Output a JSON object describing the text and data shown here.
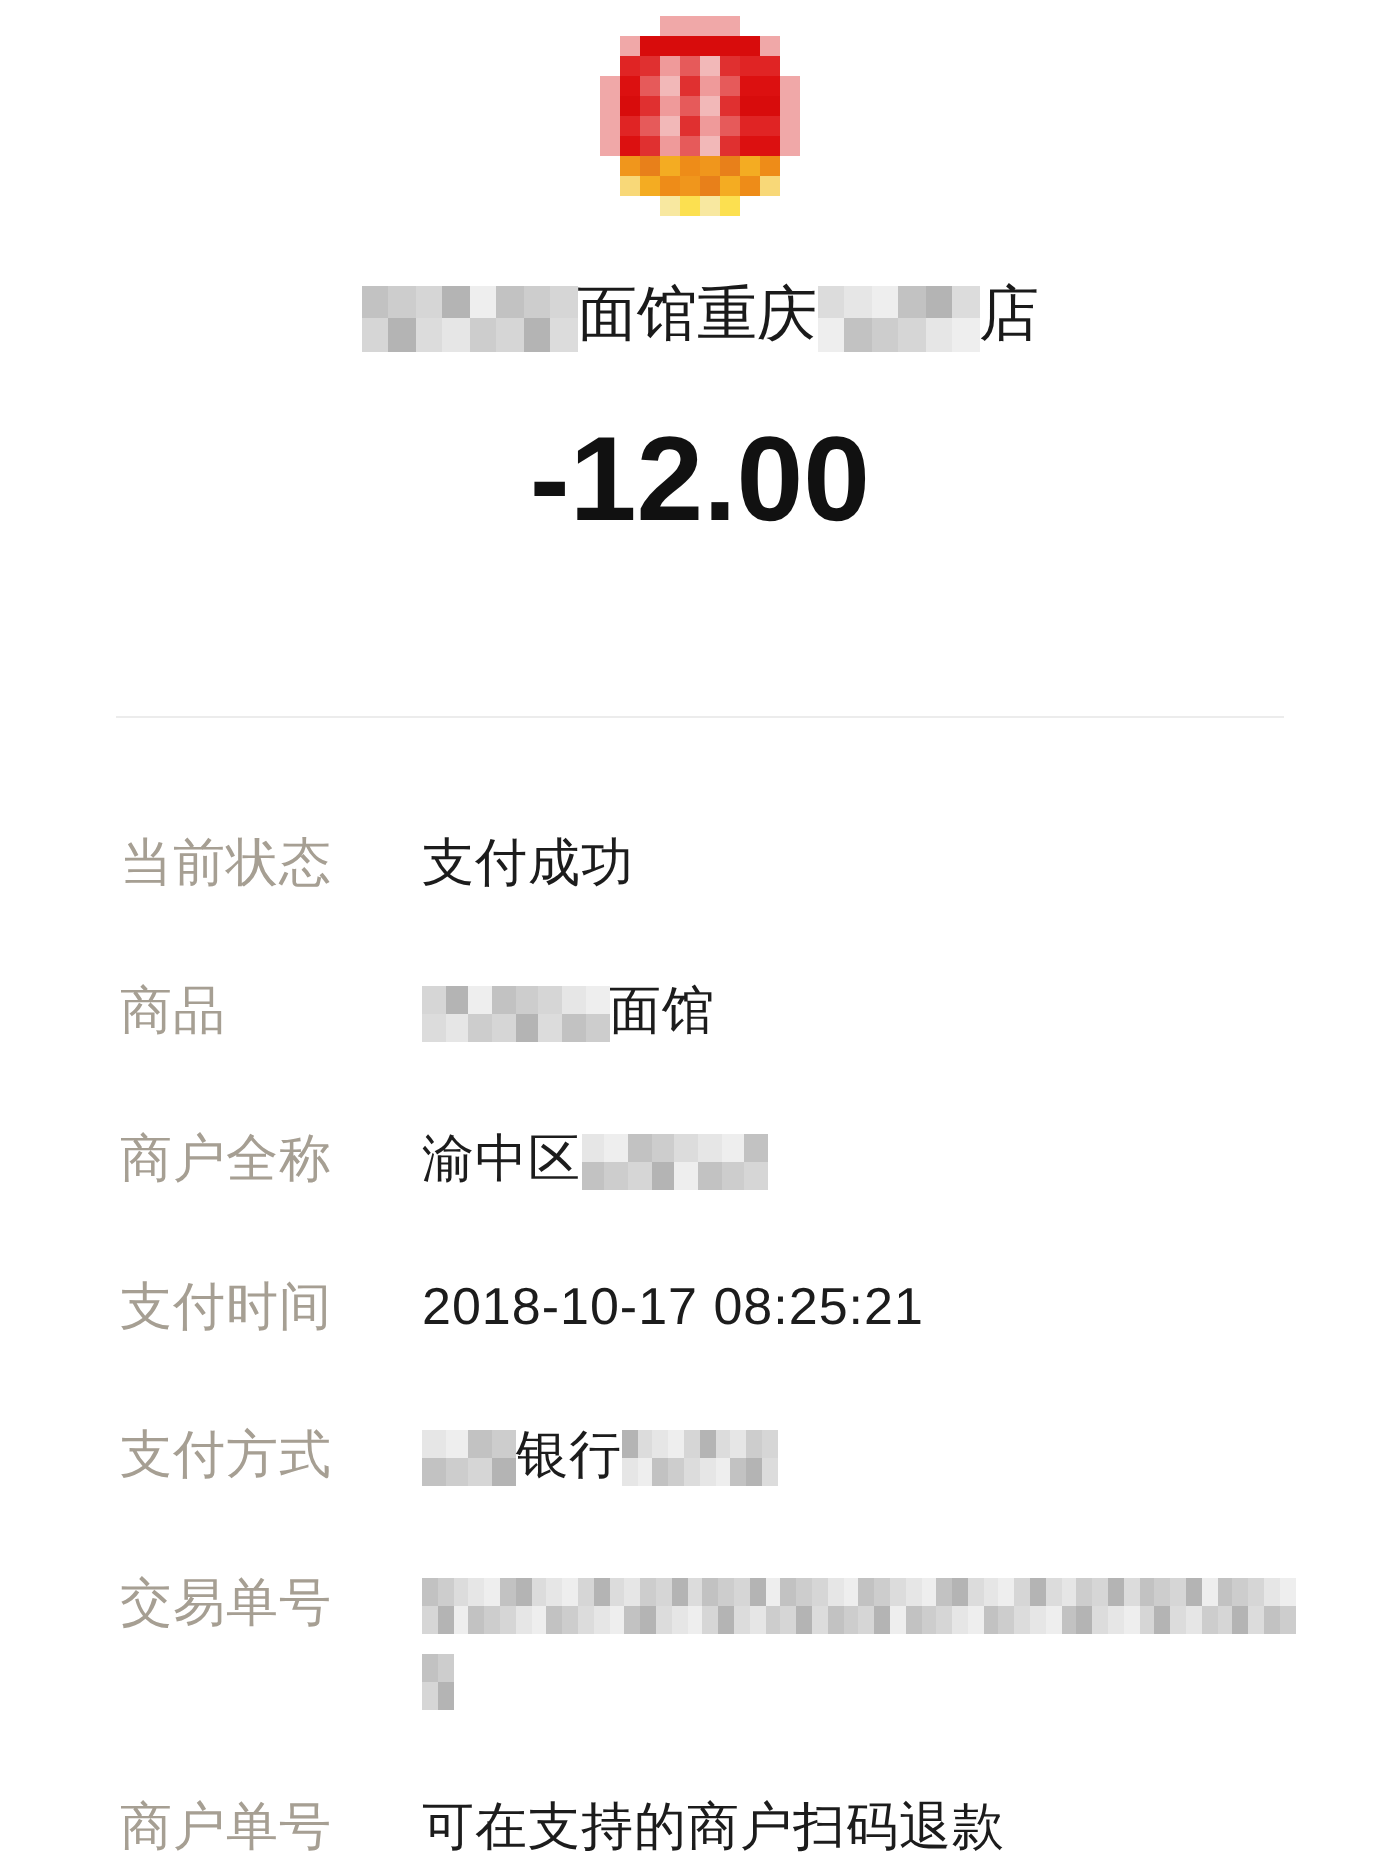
{
  "header": {
    "merchant_name": [
      {
        "kind": "blur4"
      },
      {
        "kind": "text",
        "text": "面馆重庆"
      },
      {
        "kind": "blur3"
      },
      {
        "kind": "text",
        "text": "店"
      }
    ],
    "amount": "-12.00"
  },
  "details": [
    {
      "label": "当前状态",
      "value": [
        {
          "kind": "text",
          "text": "支付成功"
        }
      ]
    },
    {
      "label": "商品",
      "value": [
        {
          "kind": "blur4"
        },
        {
          "kind": "text",
          "text": "面馆"
        }
      ]
    },
    {
      "label": "商户全称",
      "value": [
        {
          "kind": "text",
          "text": "渝中区"
        },
        {
          "kind": "blur4"
        }
      ]
    },
    {
      "label": "支付时间",
      "value": [
        {
          "kind": "text",
          "text": "2018-10-17 08:25:21"
        }
      ]
    },
    {
      "label": "支付方式",
      "value": [
        {
          "kind": "blur2"
        },
        {
          "kind": "text",
          "text": "银行"
        },
        {
          "kind": "blurdigits"
        }
      ]
    },
    {
      "label": "交易单号",
      "value": [
        {
          "kind": "blurserial"
        }
      ]
    },
    {
      "label": "商户单号",
      "value": [
        {
          "kind": "text",
          "text": "可在支持的商户扫码退款"
        }
      ]
    }
  ]
}
